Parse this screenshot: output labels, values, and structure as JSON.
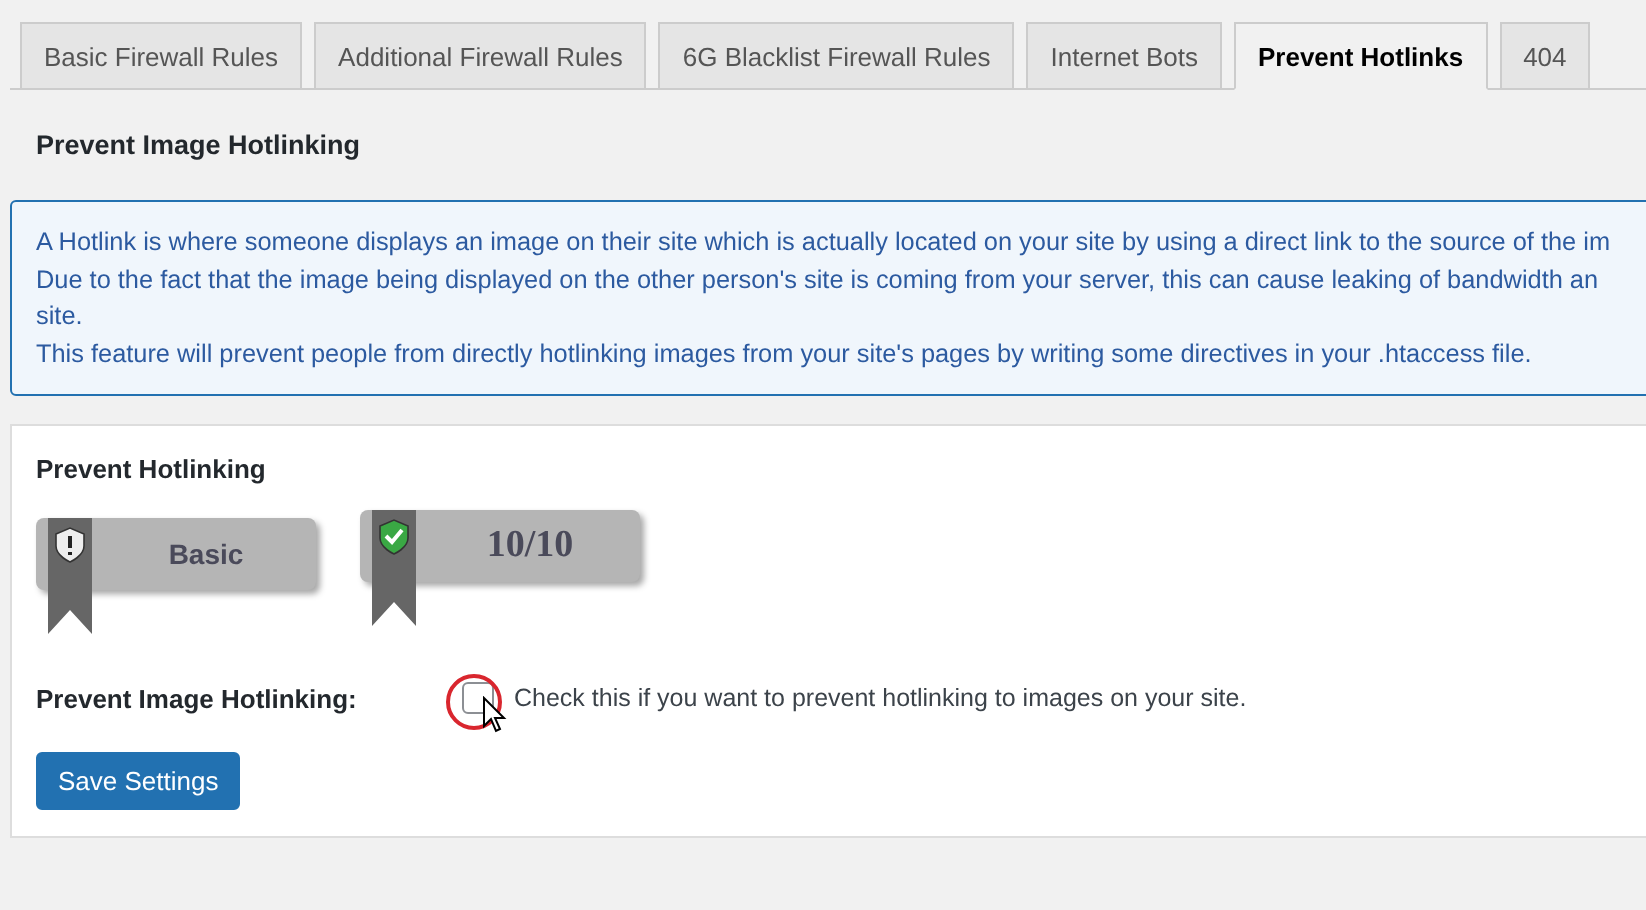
{
  "tabs": [
    {
      "label": "Basic Firewall Rules",
      "selected": false
    },
    {
      "label": "Additional Firewall Rules",
      "selected": false
    },
    {
      "label": "6G Blacklist Firewall Rules",
      "selected": false
    },
    {
      "label": "Internet Bots",
      "selected": false
    },
    {
      "label": "Prevent Hotlinks",
      "selected": true
    },
    {
      "label": "404",
      "selected": false
    }
  ],
  "page_heading": "Prevent Image Hotlinking",
  "info_lines": [
    "A Hotlink is where someone displays an image on their site which is actually located on your site by using a direct link to the source of the im",
    "Due to the fact that the image being displayed on the other person's site is coming from your server, this can cause leaking of bandwidth an",
    "site.",
    "This feature will prevent people from directly hotlinking images from your site's pages by writing some directives in your .htaccess file."
  ],
  "card": {
    "title": "Prevent Hotlinking",
    "badges": [
      {
        "kind": "level",
        "label": "Basic"
      },
      {
        "kind": "score",
        "label": "10/10"
      }
    ],
    "option": {
      "label": "Prevent Image Hotlinking:",
      "checked": false,
      "description": "Check this if you want to prevent hotlinking to images on your site."
    },
    "save_button": "Save Settings"
  }
}
